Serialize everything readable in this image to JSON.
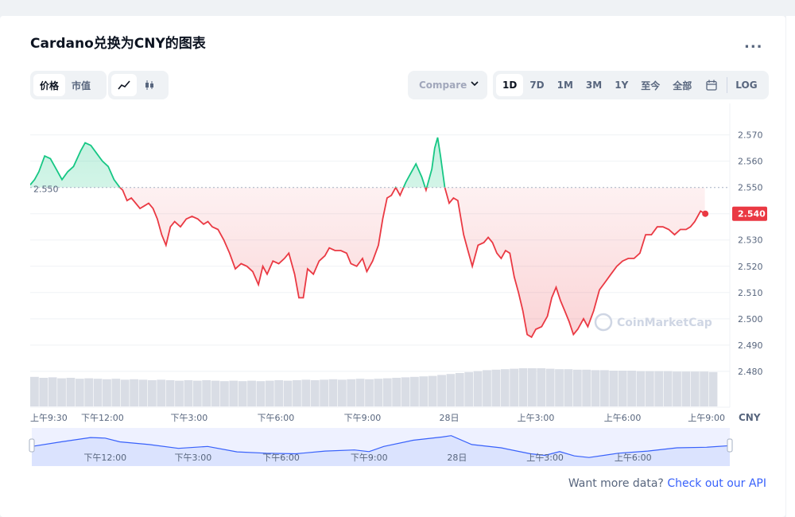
{
  "title": "Cardano兑换为CNY的图表",
  "more_label": "...",
  "view_tabs": [
    "价格",
    "市值"
  ],
  "compare_label": "Compare",
  "ranges": [
    "1D",
    "7D",
    "1M",
    "3M",
    "1Y",
    "至今",
    "全部"
  ],
  "log_label": "LOG",
  "footer": {
    "text": "Want more data?",
    "link": "Check out our API"
  },
  "watermark": "CoinMarketCap",
  "colors": {
    "up": "#16c784",
    "down": "#ea3943",
    "accent": "#3861fb"
  },
  "chart_data": {
    "type": "line",
    "currency_label": "CNY",
    "baseline": 2.55,
    "baseline_label": "2.550",
    "current_value": 2.54,
    "current_label": "2.540",
    "ylim": [
      2.473,
      2.582
    ],
    "y_ticks": [
      2.57,
      2.56,
      2.55,
      2.54,
      2.53,
      2.52,
      2.51,
      2.5,
      2.49,
      2.48
    ],
    "y_tick_labels": [
      "2.570",
      "2.560",
      "2.550",
      "2.540",
      "2.530",
      "2.520",
      "2.510",
      "2.500",
      "2.490",
      "2.480"
    ],
    "x_ticks": [
      {
        "t": 0,
        "label": "上午9:30"
      },
      {
        "t": 2.5,
        "label": "下午12:00"
      },
      {
        "t": 5.5,
        "label": "下午3:00"
      },
      {
        "t": 8.5,
        "label": "下午6:00"
      },
      {
        "t": 11.5,
        "label": "下午9:00"
      },
      {
        "t": 14.5,
        "label": "28日"
      },
      {
        "t": 17.5,
        "label": "上午3:00"
      },
      {
        "t": 20.5,
        "label": "上午6:00"
      },
      {
        "t": 23.5,
        "label": "上午9:00"
      }
    ],
    "nav_ticks": [
      {
        "t": 2.5,
        "label": "下午12:00"
      },
      {
        "t": 5.5,
        "label": "下午3:00"
      },
      {
        "t": 8.5,
        "label": "下午6:00"
      },
      {
        "t": 11.5,
        "label": "下午9:00"
      },
      {
        "t": 14.5,
        "label": "28日"
      },
      {
        "t": 17.5,
        "label": "上午3:00"
      },
      {
        "t": 20.5,
        "label": "上午6:00"
      }
    ],
    "x_range": [
      0,
      23.8
    ],
    "price": [
      [
        0.0,
        2.551
      ],
      [
        0.15,
        2.553
      ],
      [
        0.3,
        2.556
      ],
      [
        0.5,
        2.562
      ],
      [
        0.7,
        2.561
      ],
      [
        0.9,
        2.557
      ],
      [
        1.1,
        2.553
      ],
      [
        1.3,
        2.556
      ],
      [
        1.5,
        2.558
      ],
      [
        1.75,
        2.564
      ],
      [
        1.9,
        2.567
      ],
      [
        2.1,
        2.566
      ],
      [
        2.3,
        2.563
      ],
      [
        2.5,
        2.56
      ],
      [
        2.7,
        2.558
      ],
      [
        2.9,
        2.553
      ],
      [
        3.1,
        2.55
      ],
      [
        3.2,
        2.549
      ],
      [
        3.35,
        2.545
      ],
      [
        3.5,
        2.546
      ],
      [
        3.65,
        2.544
      ],
      [
        3.8,
        2.542
      ],
      [
        3.95,
        2.543
      ],
      [
        4.1,
        2.544
      ],
      [
        4.25,
        2.542
      ],
      [
        4.4,
        2.538
      ],
      [
        4.55,
        2.532
      ],
      [
        4.7,
        2.528
      ],
      [
        4.85,
        2.535
      ],
      [
        5.0,
        2.537
      ],
      [
        5.2,
        2.535
      ],
      [
        5.4,
        2.538
      ],
      [
        5.6,
        2.539
      ],
      [
        5.8,
        2.538
      ],
      [
        6.0,
        2.536
      ],
      [
        6.15,
        2.537
      ],
      [
        6.3,
        2.535
      ],
      [
        6.5,
        2.534
      ],
      [
        6.7,
        2.53
      ],
      [
        6.9,
        2.525
      ],
      [
        7.1,
        2.519
      ],
      [
        7.3,
        2.521
      ],
      [
        7.5,
        2.52
      ],
      [
        7.7,
        2.518
      ],
      [
        7.9,
        2.513
      ],
      [
        8.05,
        2.52
      ],
      [
        8.2,
        2.517
      ],
      [
        8.4,
        2.522
      ],
      [
        8.6,
        2.521
      ],
      [
        8.8,
        2.523
      ],
      [
        8.95,
        2.525
      ],
      [
        9.15,
        2.517
      ],
      [
        9.3,
        2.508
      ],
      [
        9.45,
        2.508
      ],
      [
        9.6,
        2.519
      ],
      [
        9.8,
        2.517
      ],
      [
        10.0,
        2.522
      ],
      [
        10.2,
        2.524
      ],
      [
        10.35,
        2.527
      ],
      [
        10.55,
        2.526
      ],
      [
        10.75,
        2.526
      ],
      [
        10.95,
        2.525
      ],
      [
        11.1,
        2.521
      ],
      [
        11.3,
        2.52
      ],
      [
        11.5,
        2.523
      ],
      [
        11.65,
        2.518
      ],
      [
        11.85,
        2.522
      ],
      [
        12.05,
        2.528
      ],
      [
        12.2,
        2.538
      ],
      [
        12.35,
        2.546
      ],
      [
        12.5,
        2.547
      ],
      [
        12.65,
        2.55
      ],
      [
        12.8,
        2.547
      ],
      [
        13.0,
        2.552
      ],
      [
        13.15,
        2.555
      ],
      [
        13.35,
        2.559
      ],
      [
        13.55,
        2.554
      ],
      [
        13.7,
        2.549
      ],
      [
        13.9,
        2.557
      ],
      [
        14.0,
        2.565
      ],
      [
        14.1,
        2.569
      ],
      [
        14.2,
        2.562
      ],
      [
        14.35,
        2.55
      ],
      [
        14.5,
        2.544
      ],
      [
        14.65,
        2.546
      ],
      [
        14.8,
        2.545
      ],
      [
        15.0,
        2.532
      ],
      [
        15.15,
        2.526
      ],
      [
        15.3,
        2.52
      ],
      [
        15.5,
        2.528
      ],
      [
        15.7,
        2.529
      ],
      [
        15.85,
        2.531
      ],
      [
        16.0,
        2.529
      ],
      [
        16.15,
        2.525
      ],
      [
        16.3,
        2.523
      ],
      [
        16.45,
        2.526
      ],
      [
        16.6,
        2.525
      ],
      [
        16.75,
        2.516
      ],
      [
        16.9,
        2.51
      ],
      [
        17.05,
        2.503
      ],
      [
        17.2,
        2.494
      ],
      [
        17.35,
        2.493
      ],
      [
        17.5,
        2.496
      ],
      [
        17.7,
        2.497
      ],
      [
        17.9,
        2.501
      ],
      [
        18.05,
        2.508
      ],
      [
        18.2,
        2.512
      ],
      [
        18.35,
        2.507
      ],
      [
        18.5,
        2.503
      ],
      [
        18.65,
        2.499
      ],
      [
        18.8,
        2.494
      ],
      [
        18.95,
        2.496
      ],
      [
        19.15,
        2.5
      ],
      [
        19.3,
        2.497
      ],
      [
        19.5,
        2.503
      ],
      [
        19.7,
        2.511
      ],
      [
        19.9,
        2.514
      ],
      [
        20.1,
        2.517
      ],
      [
        20.3,
        2.52
      ],
      [
        20.5,
        2.522
      ],
      [
        20.7,
        2.523
      ],
      [
        20.9,
        2.523
      ],
      [
        21.1,
        2.525
      ],
      [
        21.3,
        2.532
      ],
      [
        21.5,
        2.532
      ],
      [
        21.7,
        2.535
      ],
      [
        21.9,
        2.535
      ],
      [
        22.1,
        2.534
      ],
      [
        22.3,
        2.532
      ],
      [
        22.5,
        2.534
      ],
      [
        22.7,
        2.534
      ],
      [
        22.85,
        2.535
      ],
      [
        23.0,
        2.537
      ],
      [
        23.2,
        2.541
      ],
      [
        23.35,
        2.54
      ]
    ],
    "navigator": [
      [
        0,
        0.55
      ],
      [
        1,
        0.72
      ],
      [
        2,
        0.88
      ],
      [
        2.5,
        0.86
      ],
      [
        3,
        0.72
      ],
      [
        4,
        0.62
      ],
      [
        5,
        0.48
      ],
      [
        6,
        0.55
      ],
      [
        7,
        0.35
      ],
      [
        8,
        0.3
      ],
      [
        9,
        0.28
      ],
      [
        10,
        0.38
      ],
      [
        11,
        0.42
      ],
      [
        11.5,
        0.36
      ],
      [
        12,
        0.55
      ],
      [
        13,
        0.78
      ],
      [
        14,
        0.9
      ],
      [
        14.3,
        0.95
      ],
      [
        15,
        0.62
      ],
      [
        16,
        0.5
      ],
      [
        17,
        0.28
      ],
      [
        17.5,
        0.22
      ],
      [
        18,
        0.36
      ],
      [
        18.5,
        0.2
      ],
      [
        19,
        0.14
      ],
      [
        20,
        0.3
      ],
      [
        21,
        0.38
      ],
      [
        22,
        0.5
      ],
      [
        23,
        0.52
      ],
      [
        23.8,
        0.58
      ]
    ],
    "volume": [
      0.62,
      0.6,
      0.61,
      0.59,
      0.6,
      0.58,
      0.59,
      0.58,
      0.57,
      0.58,
      0.56,
      0.57,
      0.56,
      0.55,
      0.56,
      0.55,
      0.54,
      0.55,
      0.54,
      0.55,
      0.54,
      0.53,
      0.54,
      0.53,
      0.54,
      0.53,
      0.54,
      0.55,
      0.54,
      0.55,
      0.56,
      0.55,
      0.56,
      0.57,
      0.56,
      0.57,
      0.58,
      0.57,
      0.58,
      0.59,
      0.6,
      0.61,
      0.62,
      0.63,
      0.64,
      0.66,
      0.68,
      0.7,
      0.72,
      0.74,
      0.76,
      0.77,
      0.78,
      0.79,
      0.8,
      0.8,
      0.8,
      0.79,
      0.78,
      0.78,
      0.77,
      0.77,
      0.76,
      0.76,
      0.75,
      0.75,
      0.75,
      0.74,
      0.74,
      0.74,
      0.74,
      0.73,
      0.73,
      0.73,
      0.73,
      0.72
    ]
  }
}
